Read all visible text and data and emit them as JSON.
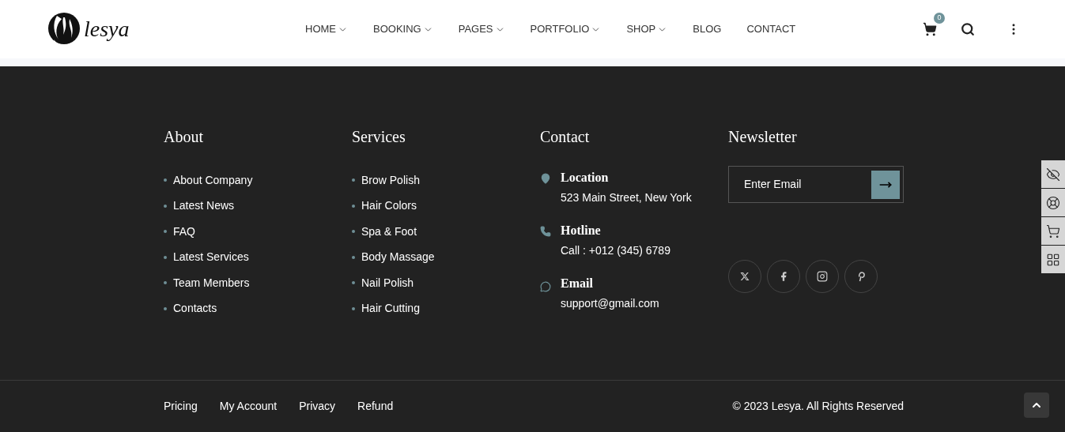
{
  "header": {
    "logo": "lesya",
    "nav": [
      {
        "label": "HOME",
        "has_dropdown": true
      },
      {
        "label": "BOOKING",
        "has_dropdown": true
      },
      {
        "label": "PAGES",
        "has_dropdown": true
      },
      {
        "label": "PORTFOLIO",
        "has_dropdown": true
      },
      {
        "label": "SHOP",
        "has_dropdown": true
      },
      {
        "label": "BLOG",
        "has_dropdown": false
      },
      {
        "label": "CONTACT",
        "has_dropdown": false
      }
    ],
    "cart_count": "0"
  },
  "footer": {
    "about": {
      "title": "About",
      "links": [
        "About Company",
        "Latest News",
        "FAQ",
        "Latest Services",
        "Team Members",
        "Contacts"
      ]
    },
    "services": {
      "title": "Services",
      "links": [
        "Brow Polish",
        "Hair Colors",
        "Spa & Foot",
        "Body Massage",
        "Nail Polish",
        "Hair Cutting"
      ]
    },
    "contact": {
      "title": "Contact",
      "items": [
        {
          "kind": "location",
          "label": "Location",
          "value": "523 Main Street, New York"
        },
        {
          "kind": "phone",
          "label": "Hotline",
          "value": "Call : +012 (345) 6789"
        },
        {
          "kind": "email",
          "label": "Email",
          "value": "support@gmail.com"
        }
      ]
    },
    "newsletter": {
      "title": "Newsletter",
      "placeholder": "Enter Email",
      "socials": [
        {
          "kind": "x"
        },
        {
          "kind": "facebook"
        },
        {
          "kind": "instagram"
        },
        {
          "kind": "pinterest"
        }
      ]
    },
    "bottom_links": [
      "Pricing",
      "My Account",
      "Privacy",
      "Refund"
    ],
    "copyright": "© 2023 Lesya. All Rights Reserved"
  },
  "side_tools": [
    {
      "kind": "hide"
    },
    {
      "kind": "support"
    },
    {
      "kind": "cart"
    },
    {
      "kind": "grid"
    }
  ]
}
